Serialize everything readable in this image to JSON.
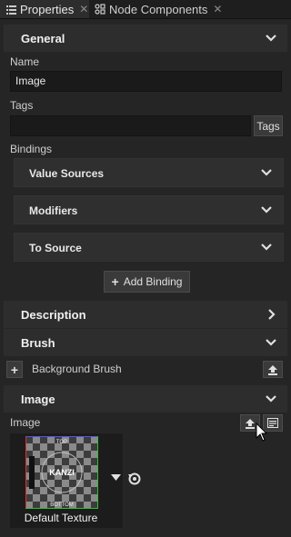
{
  "tabs": [
    {
      "label": "Properties",
      "icon": "list-icon",
      "active": true
    },
    {
      "label": "Node Components",
      "icon": "components-icon",
      "active": false
    }
  ],
  "sections": {
    "general": "General",
    "description": "Description",
    "brush": "Brush",
    "image": "Image"
  },
  "general": {
    "name_label": "Name",
    "name_value": "Image",
    "tags_label": "Tags",
    "tags_value": "",
    "tags_button": "Tags",
    "bindings_label": "Bindings",
    "subsections": [
      "Value Sources",
      "Modifiers",
      "To Source"
    ],
    "add_binding": "Add Binding"
  },
  "brush": {
    "background_brush": "Background Brush"
  },
  "image": {
    "label": "Image",
    "texture_name": "Default Texture",
    "thumb_text": {
      "top": "TOP",
      "bottom": "BOTTOM",
      "center": "KANZI"
    }
  },
  "colors": {
    "panel": "#252526",
    "section": "#2d2d2d",
    "field": "#1a1a1a"
  }
}
